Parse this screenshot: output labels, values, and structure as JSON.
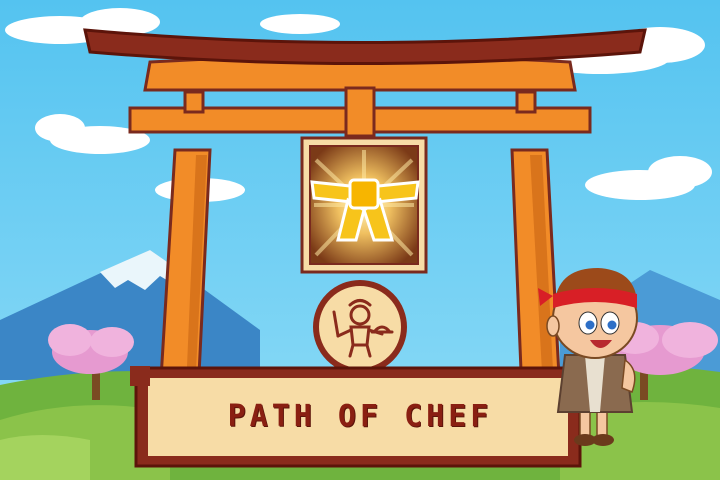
{
  "screen": {
    "title": "PATH OF CHEF"
  },
  "icons": {
    "reward": "yellow-belt-icon",
    "badge": "chef-with-knife-and-cloche-icon",
    "character": "chef-boy-red-headband"
  },
  "colors": {
    "sky": "#5ec8f0",
    "torii": "#f28c28",
    "torii_dark": "#7a2a1e",
    "belt": "#f7c41b",
    "title_text": "#8a1f12",
    "plaque": "#f7dca6",
    "grass": "#8bc34a",
    "blossom": "#e69ad0"
  }
}
